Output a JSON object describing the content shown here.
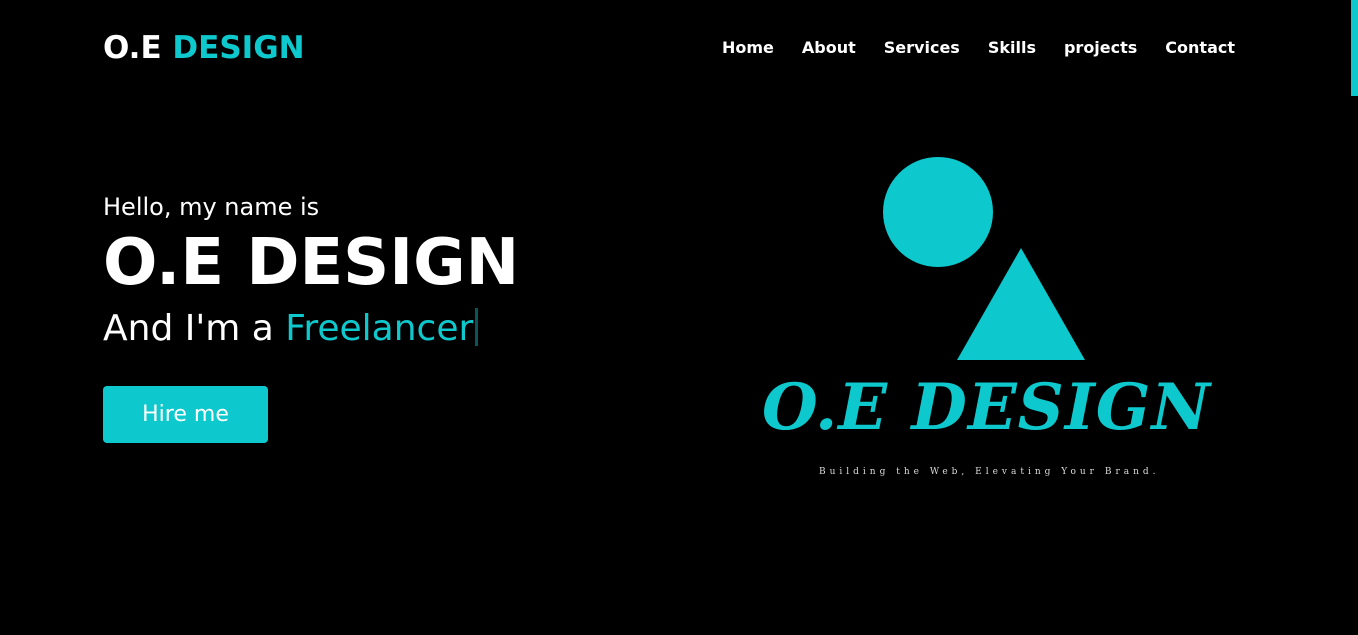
{
  "navbar": {
    "logo_main": "O.E",
    "logo_accent": "DESIGN",
    "menu": [
      {
        "label": "Home"
      },
      {
        "label": "About"
      },
      {
        "label": "Services"
      },
      {
        "label": "Skills"
      },
      {
        "label": "projects"
      },
      {
        "label": "Contact"
      }
    ]
  },
  "hero": {
    "greeting": "Hello, my name is",
    "name": "O.E DESIGN",
    "role_prefix": "And I'm a",
    "role_typed": "Freelancer",
    "cta_label": "Hire me"
  },
  "brand_graphic": {
    "wordmark": "O.E DESIGN",
    "tagline": "Building the Web, Elevating Your Brand."
  },
  "colors": {
    "background": "#000000",
    "accent": "#0dc8cc",
    "text": "#ffffff"
  },
  "icons": {
    "cursor": "text-cursor-icon"
  }
}
